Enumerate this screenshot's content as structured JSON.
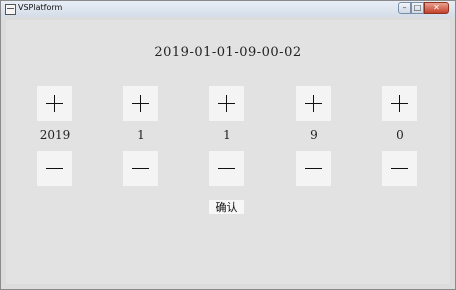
{
  "window": {
    "title": "VSPlatform",
    "controls": {
      "minimize": "–",
      "maximize": "□",
      "close": "✕"
    }
  },
  "display": {
    "datetime": "2019-01-01-09-00-02"
  },
  "fields": [
    {
      "value": "2019"
    },
    {
      "value": "1"
    },
    {
      "value": "1"
    },
    {
      "value": "9"
    },
    {
      "value": "0"
    }
  ],
  "confirm_label": "确认",
  "icons": {
    "app": "window-icon",
    "increment": "plus-icon",
    "decrement": "minus-icon"
  },
  "colors": {
    "window_bg": "#e2e2e2",
    "button_bg": "#f4f4f4",
    "close_button": "#c4402a"
  }
}
